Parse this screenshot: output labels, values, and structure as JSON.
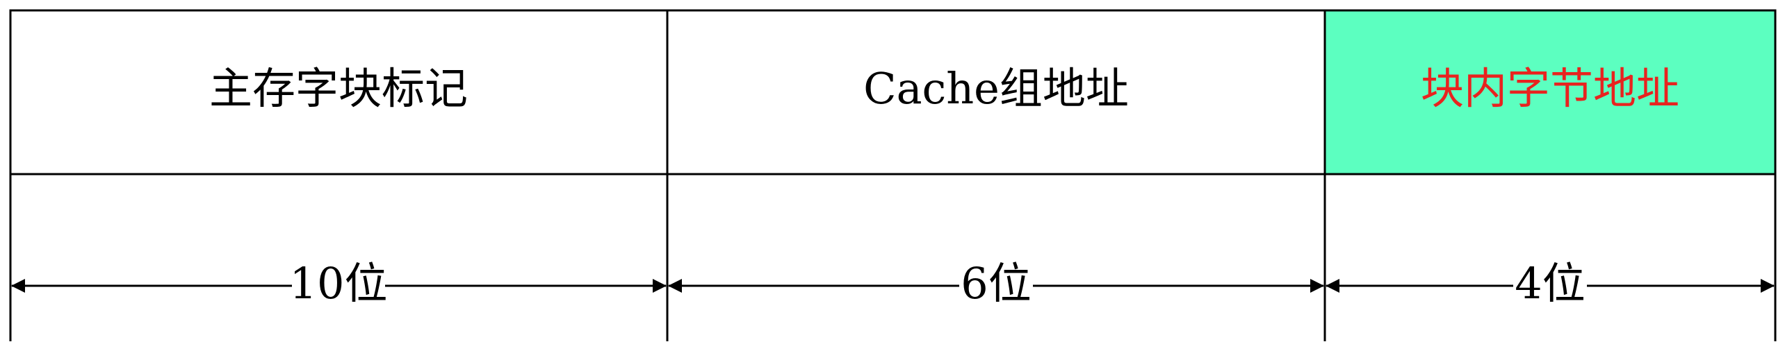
{
  "fields": [
    {
      "label": "主存字块标记",
      "width_label": "10位",
      "bits": 10,
      "fill": "#ffffff",
      "text_color": "#000000"
    },
    {
      "label": "Cache组地址",
      "width_label": "6位",
      "bits": 6,
      "fill": "#ffffff",
      "text_color": "#000000"
    },
    {
      "label": "块内字节地址",
      "width_label": "4位",
      "bits": 4,
      "fill": "#5cffc0",
      "text_color": "#e8231f"
    }
  ],
  "colors": {
    "line": "#000000",
    "highlight_fill": "#5cffc0",
    "highlight_text": "#e8231f"
  }
}
